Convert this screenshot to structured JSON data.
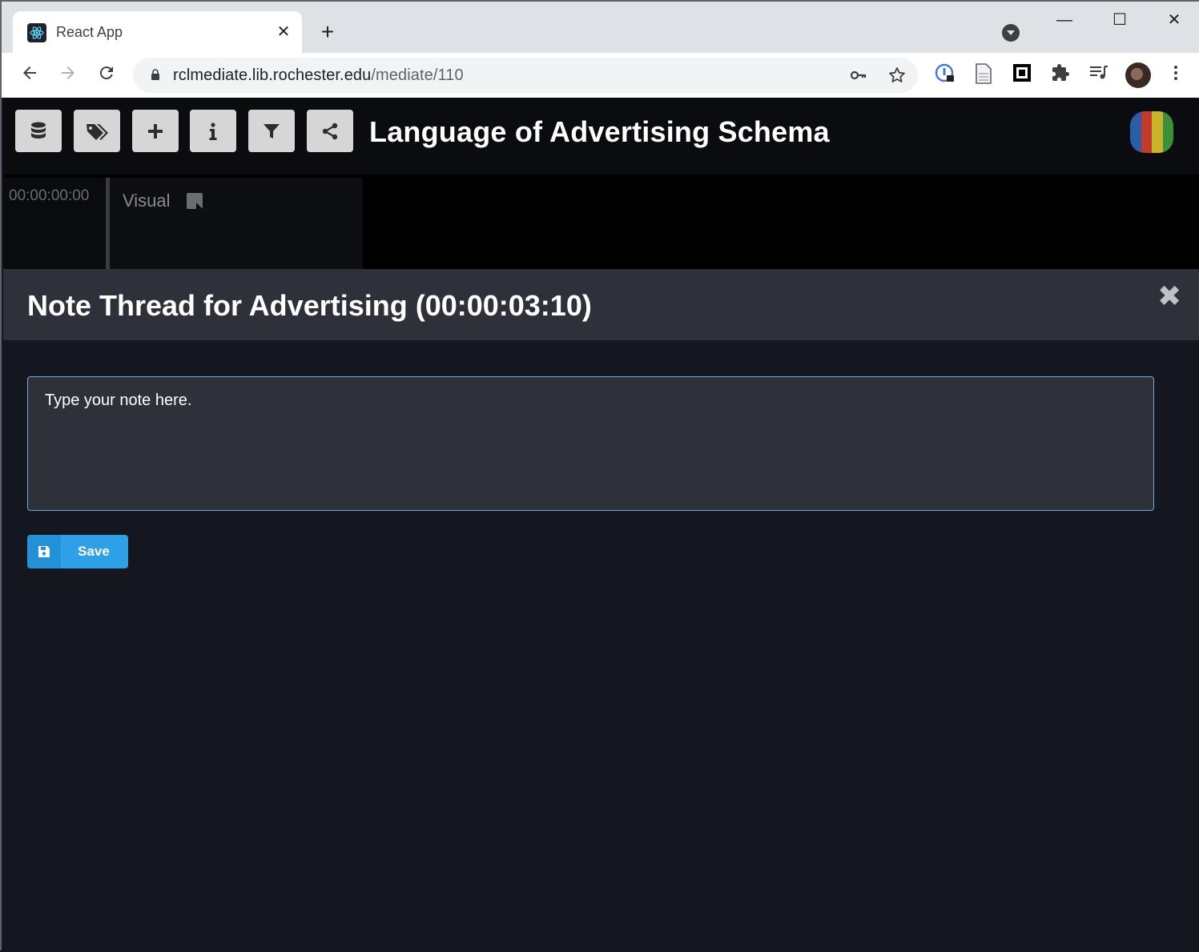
{
  "browser": {
    "tab": {
      "title": "React App",
      "close": "✕"
    },
    "new_tab": "+",
    "url": {
      "host": "rclmediate.lib.rochester.edu",
      "path": "/mediate/110"
    },
    "window": {
      "minimize": "—",
      "maximize": "☐",
      "close": "✕"
    }
  },
  "app": {
    "title": "Language of Advertising Schema",
    "toolbar_icons": [
      "database-icon",
      "tags-icon",
      "plus-icon",
      "info-icon",
      "filter-icon",
      "share-icon"
    ],
    "logo_colors": [
      "#2a5ca8",
      "#c23a2b",
      "#c9b52a",
      "#3f8f3a"
    ]
  },
  "timeline": {
    "timecode": "00:00:00:00",
    "track_label": "Visual"
  },
  "modal": {
    "title": "Note Thread for Advertising (00:00:03:10)",
    "close": "✖",
    "note_placeholder": "Type your note here.",
    "save_label": "Save"
  },
  "colors": {
    "accent": "#2ea0e8",
    "input_border": "#6fa8dc"
  }
}
